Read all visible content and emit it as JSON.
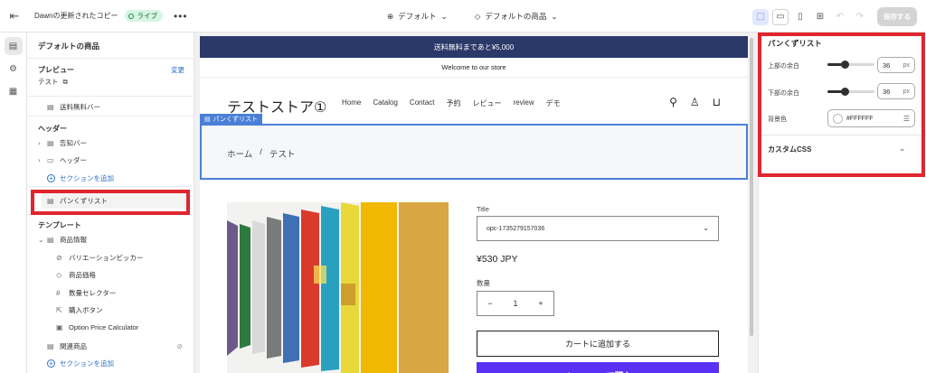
{
  "topbar": {
    "title": "Dawnの更新されたコピー",
    "live_badge": "ライブ",
    "more": "•••",
    "theme_dropdown": "デフォルト",
    "template_dropdown": "デフォルトの商品",
    "save_label": "保存する"
  },
  "sidebar": {
    "template_title": "デフォルトの商品",
    "preview_heading": "プレビュー",
    "preview_change": "変更",
    "preview_value": "テスト",
    "announcement_bar": "送料無料バー",
    "header_group": "ヘッダー",
    "header_items": [
      "告知バー",
      "ヘッダー"
    ],
    "add_section": "セクションを追加",
    "breadcrumb_item": "パンくずリスト",
    "template_group": "テンプレート",
    "product_info": "商品情報",
    "product_blocks": [
      "バリエーションピッカー",
      "商品価格",
      "数量セレクター",
      "購入ボタン",
      "Option Price Calculator"
    ],
    "related_products": "関連商品",
    "add_section_2": "セクションを追加"
  },
  "store": {
    "announcement": "送料無料まであと¥5,000",
    "welcome": "Welcome to our store",
    "logo": "テストストア①",
    "nav": [
      "Home",
      "Catalog",
      "Contact",
      "予約",
      "レビュー",
      "review",
      "デモ"
    ],
    "section_tag": "パンくずリスト",
    "breadcrumb_home": "ホーム",
    "breadcrumb_sep": "/",
    "breadcrumb_current": "テスト",
    "variant_label": "Title",
    "variant_value": "opc-1735279157036",
    "price": "¥530 JPY",
    "qty_label": "数量",
    "qty_minus": "−",
    "qty_value": "1",
    "qty_plus": "+",
    "add_to_cart": "カートに追加する",
    "shop_pay": "shop Pay で購入"
  },
  "settings_panel": {
    "title": "パンくずリスト",
    "top_padding_label": "上部の余白",
    "top_padding_value": "36",
    "top_padding_fraction": 0.36,
    "bottom_padding_label": "下部の余白",
    "bottom_padding_value": "36",
    "bottom_padding_fraction": 0.36,
    "unit": "px",
    "bg_label": "背景色",
    "bg_value": "#FFFFFF",
    "custom_css": "カスタムCSS"
  },
  "colors": {
    "announcement_bg": "#2a3968",
    "highlight": "#e0262f",
    "section_outline": "#4a7fd8",
    "shop_pay": "#5a31f4"
  }
}
